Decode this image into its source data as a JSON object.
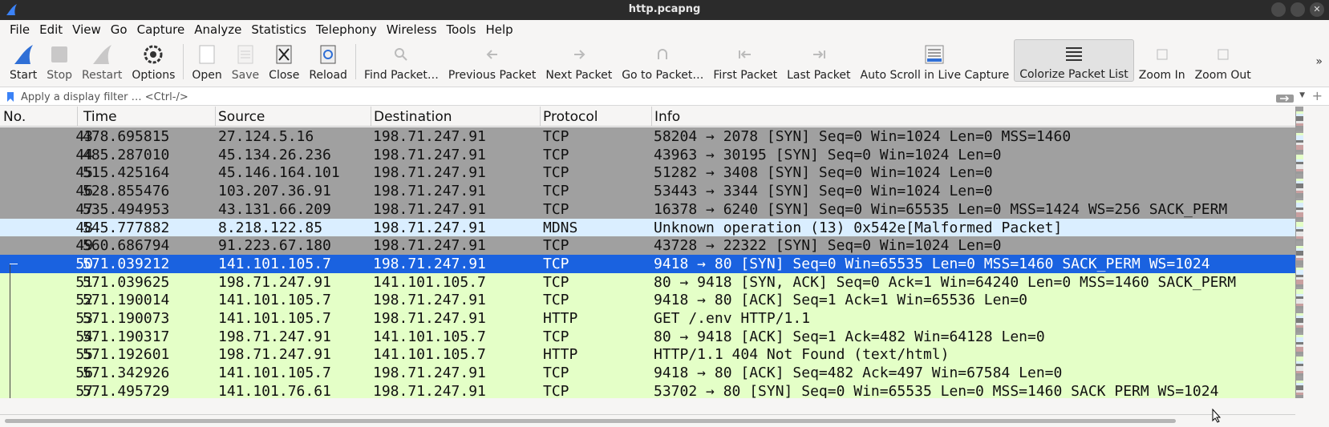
{
  "window": {
    "title": "http.pcapng"
  },
  "menu": [
    "File",
    "Edit",
    "View",
    "Go",
    "Capture",
    "Analyze",
    "Statistics",
    "Telephony",
    "Wireless",
    "Tools",
    "Help"
  ],
  "toolbar": {
    "start": "Start",
    "stop": "Stop",
    "restart": "Restart",
    "options": "Options",
    "open": "Open",
    "save": "Save",
    "close": "Close",
    "reload": "Reload",
    "find": "Find Packet…",
    "previous": "Previous Packet",
    "next": "Next Packet",
    "goto": "Go to Packet…",
    "first": "First Packet",
    "last": "Last Packet",
    "autoscroll": "Auto Scroll in Live Capture",
    "colorize": "Colorize Packet List",
    "zoom_in": "Zoom In",
    "zoom_out": "Zoom Out",
    "more": "»"
  },
  "filter": {
    "placeholder": "Apply a display filter … <Ctrl-/>"
  },
  "columns": {
    "no": "No.",
    "time": "Time",
    "source": "Source",
    "destination": "Destination",
    "protocol": "Protocol",
    "info": "Info"
  },
  "colors": {
    "tcp_syn_bg": "#a0a0a0",
    "mdns_bg": "#daeeff",
    "selected_bg": "#1a62e0",
    "http_bg": "#e4ffc7",
    "selected_fg": "#ffffff"
  },
  "packets": [
    {
      "no": "43",
      "time": "478.695815",
      "source": "27.124.5.16",
      "destination": "198.71.247.91",
      "protocol": "TCP",
      "info": "58204 → 2078 [SYN] Seq=0 Win=1024 Len=0 MSS=1460",
      "style": "syn"
    },
    {
      "no": "44",
      "time": "485.287010",
      "source": "45.134.26.236",
      "destination": "198.71.247.91",
      "protocol": "TCP",
      "info": "43963 → 30195 [SYN] Seq=0 Win=1024 Len=0",
      "style": "syn"
    },
    {
      "no": "45",
      "time": "515.425164",
      "source": "45.146.164.101",
      "destination": "198.71.247.91",
      "protocol": "TCP",
      "info": "51282 → 3408 [SYN] Seq=0 Win=1024 Len=0",
      "style": "syn"
    },
    {
      "no": "46",
      "time": "528.855476",
      "source": "103.207.36.91",
      "destination": "198.71.247.91",
      "protocol": "TCP",
      "info": "53443 → 3344 [SYN] Seq=0 Win=1024 Len=0",
      "style": "syn"
    },
    {
      "no": "47",
      "time": "535.494953",
      "source": "43.131.66.209",
      "destination": "198.71.247.91",
      "protocol": "TCP",
      "info": "16378 → 6240 [SYN] Seq=0 Win=65535 Len=0 MSS=1424 WS=256 SACK_PERM",
      "style": "syn"
    },
    {
      "no": "48",
      "time": "545.777882",
      "source": "8.218.122.85",
      "destination": "198.71.247.91",
      "protocol": "MDNS",
      "info": "Unknown operation (13) 0x542e[Malformed Packet]",
      "style": "mdns"
    },
    {
      "no": "49",
      "time": "560.686794",
      "source": "91.223.67.180",
      "destination": "198.71.247.91",
      "protocol": "TCP",
      "info": "43728 → 22322 [SYN] Seq=0 Win=1024 Len=0",
      "style": "syn"
    },
    {
      "no": "50",
      "time": "571.039212",
      "source": "141.101.105.7",
      "destination": "198.71.247.91",
      "protocol": "TCP",
      "info": "9418 → 80 [SYN] Seq=0 Win=65535 Len=0 MSS=1460 SACK_PERM WS=1024",
      "style": "selected"
    },
    {
      "no": "51",
      "time": "571.039625",
      "source": "198.71.247.91",
      "destination": "141.101.105.7",
      "protocol": "TCP",
      "info": "80 → 9418 [SYN, ACK] Seq=0 Ack=1 Win=64240 Len=0 MSS=1460 SACK_PERM",
      "style": "http"
    },
    {
      "no": "52",
      "time": "571.190014",
      "source": "141.101.105.7",
      "destination": "198.71.247.91",
      "protocol": "TCP",
      "info": "9418 → 80 [ACK] Seq=1 Ack=1 Win=65536 Len=0",
      "style": "http"
    },
    {
      "no": "53",
      "time": "571.190073",
      "source": "141.101.105.7",
      "destination": "198.71.247.91",
      "protocol": "HTTP",
      "info": "GET /.env HTTP/1.1",
      "style": "http"
    },
    {
      "no": "54",
      "time": "571.190317",
      "source": "198.71.247.91",
      "destination": "141.101.105.7",
      "protocol": "TCP",
      "info": "80 → 9418 [ACK] Seq=1 Ack=482 Win=64128 Len=0",
      "style": "http"
    },
    {
      "no": "55",
      "time": "571.192601",
      "source": "198.71.247.91",
      "destination": "141.101.105.7",
      "protocol": "HTTP",
      "info": "HTTP/1.1 404 Not Found  (text/html)",
      "style": "http"
    },
    {
      "no": "56",
      "time": "571.342926",
      "source": "141.101.105.7",
      "destination": "198.71.247.91",
      "protocol": "TCP",
      "info": "9418 → 80 [ACK] Seq=482 Ack=497 Win=67584 Len=0",
      "style": "http"
    },
    {
      "no": "57",
      "time": "571.495729",
      "source": "141.101.76.61",
      "destination": "198.71.247.91",
      "protocol": "TCP",
      "info": "53702 → 80 [SYN] Seq=0 Win=65535 Len=0 MSS=1460 SACK_PERM WS=1024",
      "style": "http"
    }
  ]
}
